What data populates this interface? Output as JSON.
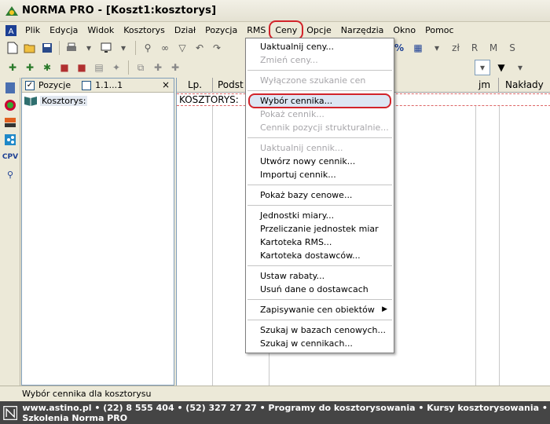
{
  "window": {
    "title": "NORMA PRO - [Koszt1:kosztorys]"
  },
  "menubar": {
    "items": [
      "Plik",
      "Edycja",
      "Widok",
      "Kosztorys",
      "Dział",
      "Pozycja",
      "RMS",
      "Ceny",
      "Opcje",
      "Narzędzia",
      "Okno",
      "Pomoc"
    ],
    "active": "Ceny"
  },
  "toolbar": {
    "ops": [
      "%",
      "zł",
      "R",
      "M",
      "S"
    ]
  },
  "tree": {
    "checkbox1_label": "Pozycje",
    "checkbox2_label": "1.1...1",
    "close": "×",
    "node_label": "Kosztorys:"
  },
  "grid": {
    "columns": [
      "Lp.",
      "Podst",
      "jm",
      "Nakłady"
    ],
    "row1_text": "KOSZTORYS:"
  },
  "menu_ceny": {
    "groups": [
      [
        {
          "label": "Uaktualnij ceny...",
          "enabled": true
        },
        {
          "label": "Zmień ceny...",
          "enabled": false
        }
      ],
      [
        {
          "label": "Wyłączone szukanie cen",
          "enabled": false
        }
      ],
      [
        {
          "label": "Wybór cennika...",
          "enabled": true,
          "highlighted": true
        },
        {
          "label": "Pokaż cennik...",
          "enabled": false
        },
        {
          "label": "Cennik pozycji strukturalnie...",
          "enabled": false
        }
      ],
      [
        {
          "label": "Uaktualnij cennik...",
          "enabled": false
        },
        {
          "label": "Utwórz nowy cennik...",
          "enabled": true
        },
        {
          "label": "Importuj cennik...",
          "enabled": true
        }
      ],
      [
        {
          "label": "Pokaż bazy cenowe...",
          "enabled": true
        }
      ],
      [
        {
          "label": "Jednostki miary...",
          "enabled": true
        },
        {
          "label": "Przeliczanie jednostek miar",
          "enabled": true
        },
        {
          "label": "Kartoteka RMS...",
          "enabled": true
        },
        {
          "label": "Kartoteka dostawców...",
          "enabled": true
        }
      ],
      [
        {
          "label": "Ustaw rabaty...",
          "enabled": true
        },
        {
          "label": "Usuń dane o dostawcach",
          "enabled": true
        }
      ],
      [
        {
          "label": "Zapisywanie cen obiektów",
          "enabled": true,
          "submenu": true
        }
      ],
      [
        {
          "label": "Szukaj w bazach cenowych...",
          "enabled": true
        },
        {
          "label": "Szukaj w cennikach...",
          "enabled": true
        }
      ]
    ]
  },
  "statusbar": {
    "text": "Wybór cennika dla kosztorysu"
  },
  "footer": {
    "text": "www.astino.pl  •  (22) 8 555 404  •  (52) 327 27 27  •  Programy do kosztorysowania  •  Kursy kosztorysowania  •  Szkolenia Norma PRO"
  },
  "colors": {
    "highlight_ring": "#d2232a",
    "highlight_bg": "#dde6f3",
    "disabled_text": "#a7a6aa",
    "footer_bg": "#454545"
  }
}
